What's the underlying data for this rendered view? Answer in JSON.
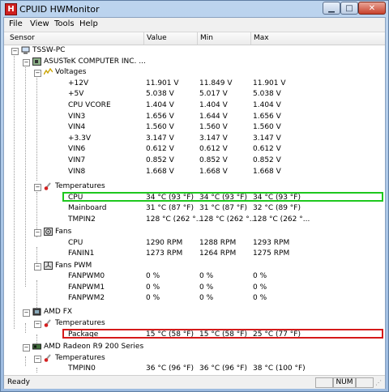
{
  "window": {
    "title": "CPUID HWMonitor",
    "app_icon_letter": "H"
  },
  "menu": [
    "File",
    "View",
    "Tools",
    "Help"
  ],
  "columns": {
    "sensor": "Sensor",
    "value": "Value",
    "min": "Min",
    "max": "Max"
  },
  "tree": {
    "root": "TSSW-PC",
    "mobo": "ASUSTeK COMPUTER INC. ...",
    "voltages_label": "Voltages",
    "voltages": [
      {
        "name": "+12V",
        "value": "11.901 V",
        "min": "11.849 V",
        "max": "11.901 V"
      },
      {
        "name": "+5V",
        "value": "5.038 V",
        "min": "5.017 V",
        "max": "5.038 V"
      },
      {
        "name": "CPU VCORE",
        "value": "1.404 V",
        "min": "1.404 V",
        "max": "1.404 V"
      },
      {
        "name": "VIN3",
        "value": "1.656 V",
        "min": "1.644 V",
        "max": "1.656 V"
      },
      {
        "name": "VIN4",
        "value": "1.560 V",
        "min": "1.560 V",
        "max": "1.560 V"
      },
      {
        "name": "+3.3V",
        "value": "3.147 V",
        "min": "3.147 V",
        "max": "3.147 V"
      },
      {
        "name": "VIN6",
        "value": "0.612 V",
        "min": "0.612 V",
        "max": "0.612 V"
      },
      {
        "name": "VIN7",
        "value": "0.852 V",
        "min": "0.852 V",
        "max": "0.852 V"
      },
      {
        "name": "VIN8",
        "value": "1.668 V",
        "min": "1.668 V",
        "max": "1.668 V"
      }
    ],
    "temps_label": "Temperatures",
    "temps": [
      {
        "name": "CPU",
        "value": "34 °C  (93 °F)",
        "min": "34 °C  (93 °F)",
        "max": "34 °C  (93 °F)"
      },
      {
        "name": "Mainboard",
        "value": "31 °C  (87 °F)",
        "min": "31 °C  (87 °F)",
        "max": "32 °C  (89 °F)"
      },
      {
        "name": "TMPIN2",
        "value": "128 °C  (262 °...",
        "min": "128 °C  (262 °...",
        "max": "128 °C  (262 °..."
      }
    ],
    "fans_label": "Fans",
    "fans": [
      {
        "name": "CPU",
        "value": "1290 RPM",
        "min": "1288 RPM",
        "max": "1293 RPM"
      },
      {
        "name": "FANIN1",
        "value": "1273 RPM",
        "min": "1264 RPM",
        "max": "1275 RPM"
      }
    ],
    "fanpwm_label": "Fans PWM",
    "fanpwm": [
      {
        "name": "FANPWM0",
        "value": "0 %",
        "min": "0 %",
        "max": "0 %"
      },
      {
        "name": "FANPWM1",
        "value": "0 %",
        "min": "0 %",
        "max": "0 %"
      },
      {
        "name": "FANPWM2",
        "value": "0 %",
        "min": "0 %",
        "max": "0 %"
      }
    ],
    "cpu_device": "AMD FX",
    "cpu_temps_label": "Temperatures",
    "cpu_temps": [
      {
        "name": "Package",
        "value": "15 °C  (58 °F)",
        "min": "15 °C  (58 °F)",
        "max": "25 °C  (77 °F)"
      }
    ],
    "gpu_device": "AMD Radeon R9 200 Series",
    "gpu_temps_label": "Temperatures",
    "gpu_temps": [
      {
        "name": "TMPIN0",
        "value": "36 °C  (96 °F)",
        "min": "36 °C  (96 °F)",
        "max": "38 °C  (100 °F)"
      }
    ]
  },
  "status": {
    "text": "Ready",
    "num": "NUM"
  },
  "colors": {
    "highlight_green": "#1ec81e",
    "highlight_red": "#d51a1a",
    "close_button": "#c7412c"
  }
}
